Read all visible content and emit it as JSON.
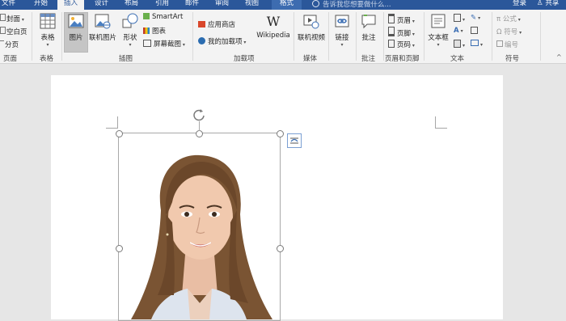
{
  "tabs": {
    "file": "文件",
    "home": "开始",
    "insert": "插入",
    "design": "设计",
    "layout": "布局",
    "references": "引用",
    "mailings": "邮件",
    "review": "审阅",
    "view": "视图",
    "format": "格式"
  },
  "tell_me": "告诉我您想要做什么...",
  "login": "登录",
  "share": "共享",
  "groups": {
    "pages": {
      "label": "页面",
      "items": [
        "封面",
        "空白页",
        "分页"
      ]
    },
    "tables": {
      "label": "表格",
      "table": "表格"
    },
    "illustrations": {
      "label": "插图",
      "picture": "图片",
      "online_picture": "联机图片",
      "shapes": "形状",
      "smartart": "SmartArt",
      "chart": "图表",
      "screenshot": "屏幕截图"
    },
    "addins": {
      "label": "加载项",
      "store": "应用商店",
      "my_addins": "我的加载项",
      "wikipedia": "Wikipedia"
    },
    "media": {
      "label": "媒体",
      "online_video": "联机视频"
    },
    "links": {
      "link": "链接"
    },
    "comments": {
      "label": "批注",
      "comment": "批注"
    },
    "header_footer": {
      "label": "页眉和页脚",
      "header": "页眉",
      "footer": "页脚",
      "page_number": "页码"
    },
    "text": {
      "label": "文本",
      "textbox": "文本框"
    },
    "symbols": {
      "label": "符号",
      "equation": "公式",
      "symbol": "符号",
      "number": "编号"
    }
  },
  "colors": {
    "tab_bar": "#2b579a",
    "ribbon": "#f3f3f3",
    "canvas": "#e6e6e6"
  }
}
